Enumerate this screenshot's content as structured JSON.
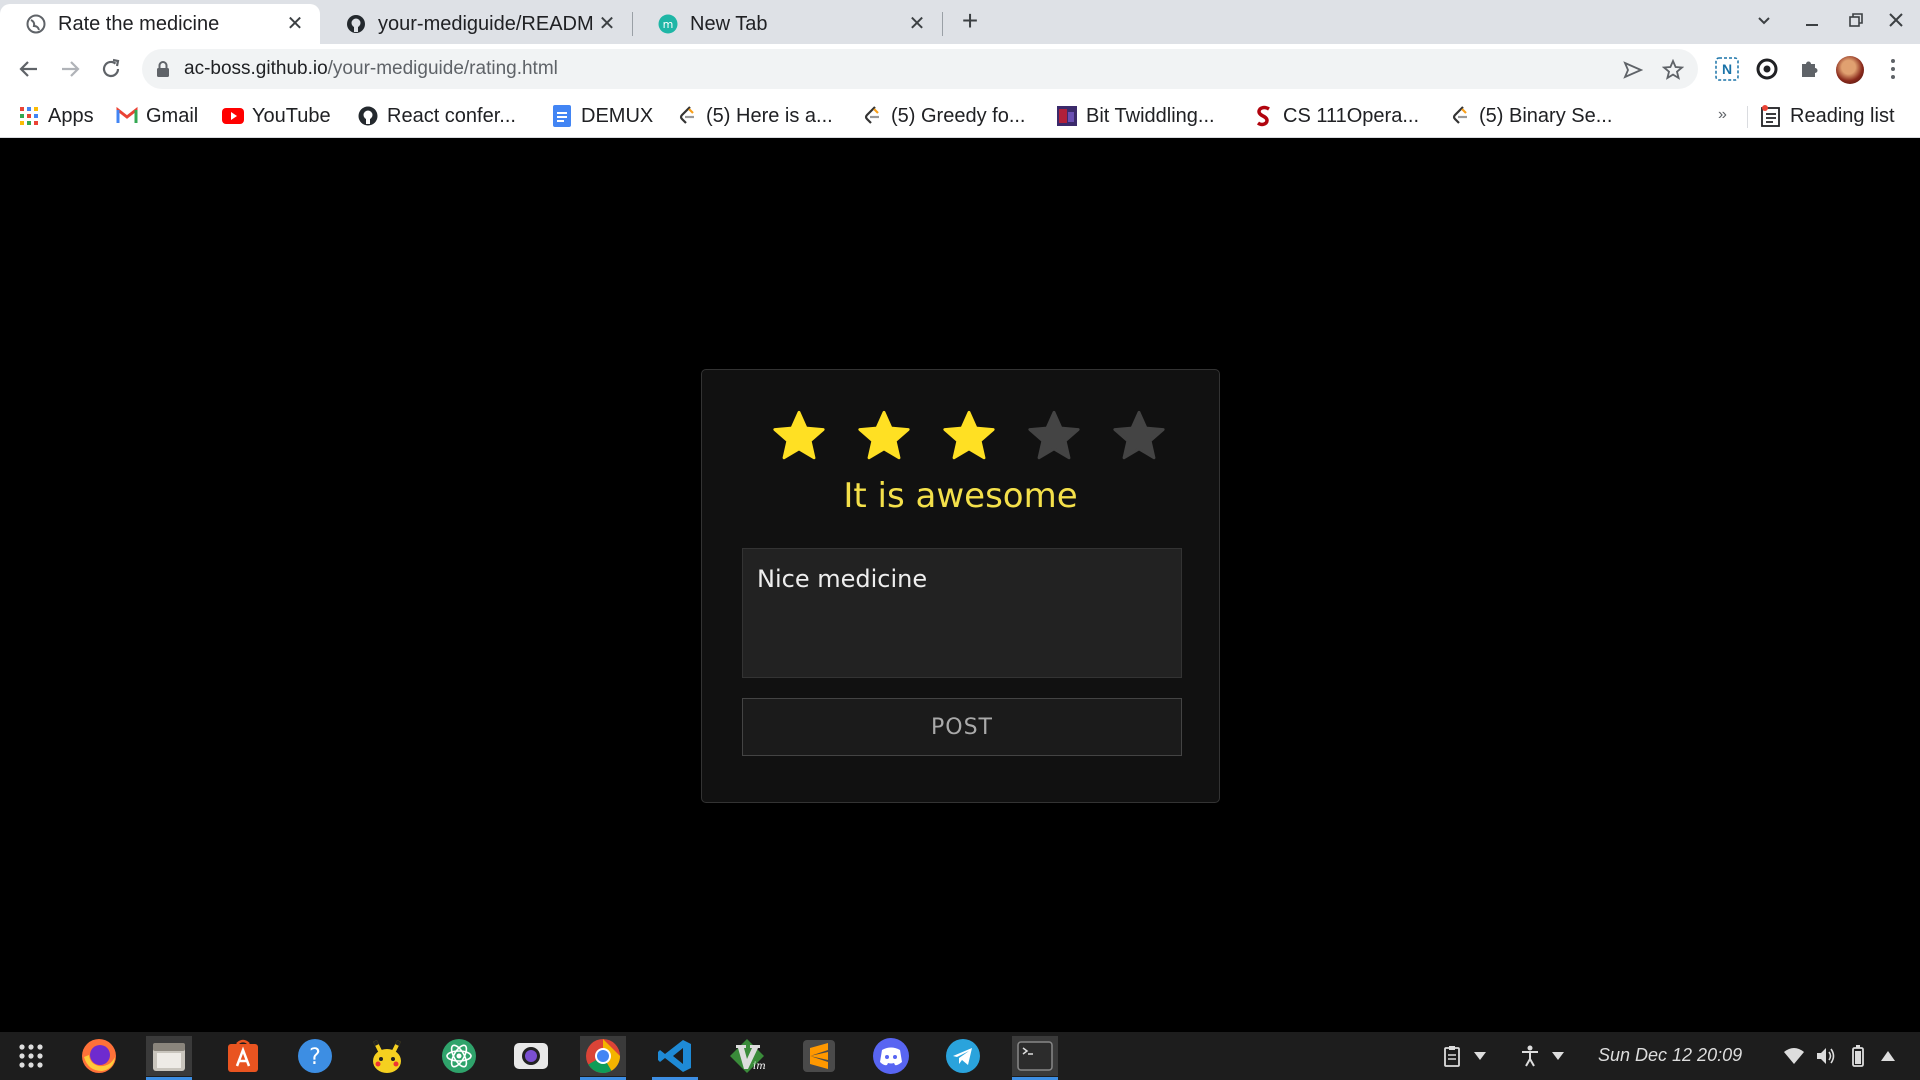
{
  "browser": {
    "tabs": [
      {
        "title": "Rate the medicine",
        "active": true,
        "favicon": "globe-icon"
      },
      {
        "title": "your-mediguide/READM",
        "active": false,
        "favicon": "github-icon"
      },
      {
        "title": "New Tab",
        "active": false,
        "favicon": "m-icon"
      }
    ],
    "url_host": "ac-boss.github.io",
    "url_path": "/your-mediguide/rating.html",
    "bookmarks": [
      {
        "label": "Apps",
        "icon": "apps-grid-icon"
      },
      {
        "label": "Gmail",
        "icon": "gmail-icon"
      },
      {
        "label": "YouTube",
        "icon": "youtube-icon"
      },
      {
        "label": "React confer...",
        "icon": "github-icon"
      },
      {
        "label": "DEMUX",
        "icon": "docs-icon"
      },
      {
        "label": "(5) Here is a...",
        "icon": "leetcode-icon"
      },
      {
        "label": "(5) Greedy fo...",
        "icon": "leetcode-icon"
      },
      {
        "label": "Bit Twiddling...",
        "icon": "bookmark-image-icon"
      },
      {
        "label": "CS 111Opera...",
        "icon": "stanford-icon"
      },
      {
        "label": "(5) Binary Se...",
        "icon": "leetcode-icon"
      }
    ],
    "more_bookmarks": "»",
    "reading_list": "Reading list"
  },
  "rating": {
    "value": 3,
    "max": 5,
    "label": "It is awesome",
    "review_text": "Nice medicine",
    "post_label": "POST",
    "colors": {
      "filled": "#ffe023",
      "empty": "#444444",
      "label": "#f4e04a"
    }
  },
  "taskbar": {
    "apps": [
      "apps-grid-icon",
      "firefox-icon",
      "files-icon",
      "software-center-icon",
      "help-icon",
      "pikachu-icon",
      "atom-icon",
      "camera-icon",
      "chrome-icon",
      "vscode-icon",
      "vim-icon",
      "sublime-icon",
      "discord-icon",
      "telegram-icon",
      "terminal-icon"
    ],
    "clock": "Sun Dec 12  20:09"
  }
}
